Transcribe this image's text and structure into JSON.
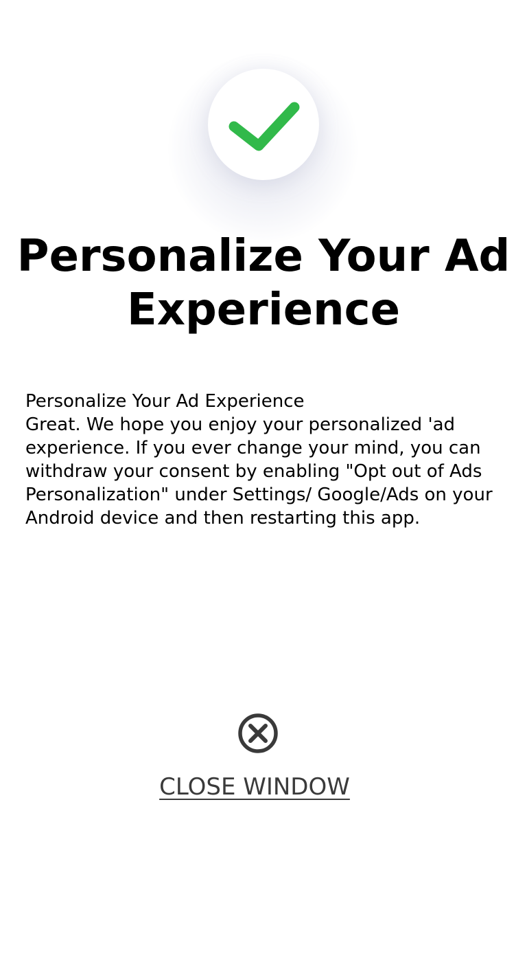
{
  "success_icon": {
    "icon": "checkmark-icon",
    "color": "#31b94a"
  },
  "title": "Personalize Your Ad Experience",
  "message": {
    "heading": "Personalize Your Ad Experience",
    "body": "Great. We hope you enjoy your personalized 'ad experience. If you ever change your mind, you can withdraw your consent by enabling \"Opt out of Ads Personalization\" under Settings/ Google/Ads on your Android device and then restarting this app."
  },
  "close": {
    "icon": "close-circle-icon",
    "label": "CLOSE WINDOW",
    "color": "#3a3a3a"
  }
}
